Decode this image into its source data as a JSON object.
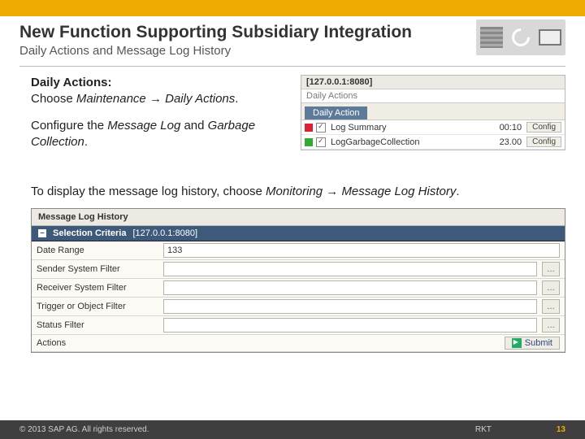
{
  "header": {
    "title": "New Function Supporting Subsidiary Integration",
    "subtitle": "Daily Actions and Message Log History"
  },
  "left": {
    "heading": "Daily Actions:",
    "p1_pre": "Choose ",
    "p1_i1": "Maintenance",
    "p1_arrow": " → ",
    "p1_i2": "Daily Actions",
    "p1_post": ".",
    "p2_pre": "Configure the ",
    "p2_i1": "Message Log",
    "p2_mid": " and ",
    "p2_i2": "Garbage Collection",
    "p2_post": "."
  },
  "daily_panel": {
    "ip": "[127.0.0.1:8080]",
    "crumb": "Daily Actions",
    "tab": "Daily Action",
    "rows": [
      {
        "name": "Log Summary",
        "time": "00:10",
        "btn": "Config"
      },
      {
        "name": "LogGarbageCollection",
        "time": "23.00",
        "btn": "Config"
      }
    ]
  },
  "midline": {
    "pre": "To display the message log history, choose ",
    "i1": "Monitoring",
    "arrow": " → ",
    "i2": "Message Log History",
    "post": "."
  },
  "mlh": {
    "title": "Message Log History",
    "bar_label": "Selection Criteria",
    "bar_ip": "[127.0.0.1:8080]",
    "rows": {
      "date_range": {
        "label": "Date Range",
        "value": "133"
      },
      "sender": {
        "label": "Sender System Filter",
        "value": ""
      },
      "receiver": {
        "label": "Receiver System Filter",
        "value": ""
      },
      "trigger": {
        "label": "Trigger or Object Filter",
        "value": ""
      },
      "status": {
        "label": "Status Filter",
        "value": ""
      },
      "actions": {
        "label": "Actions",
        "submit": "Submit"
      }
    }
  },
  "footer": {
    "copy": "© 2013 SAP AG. All rights reserved.",
    "rkt": "RKT",
    "page": "13"
  }
}
